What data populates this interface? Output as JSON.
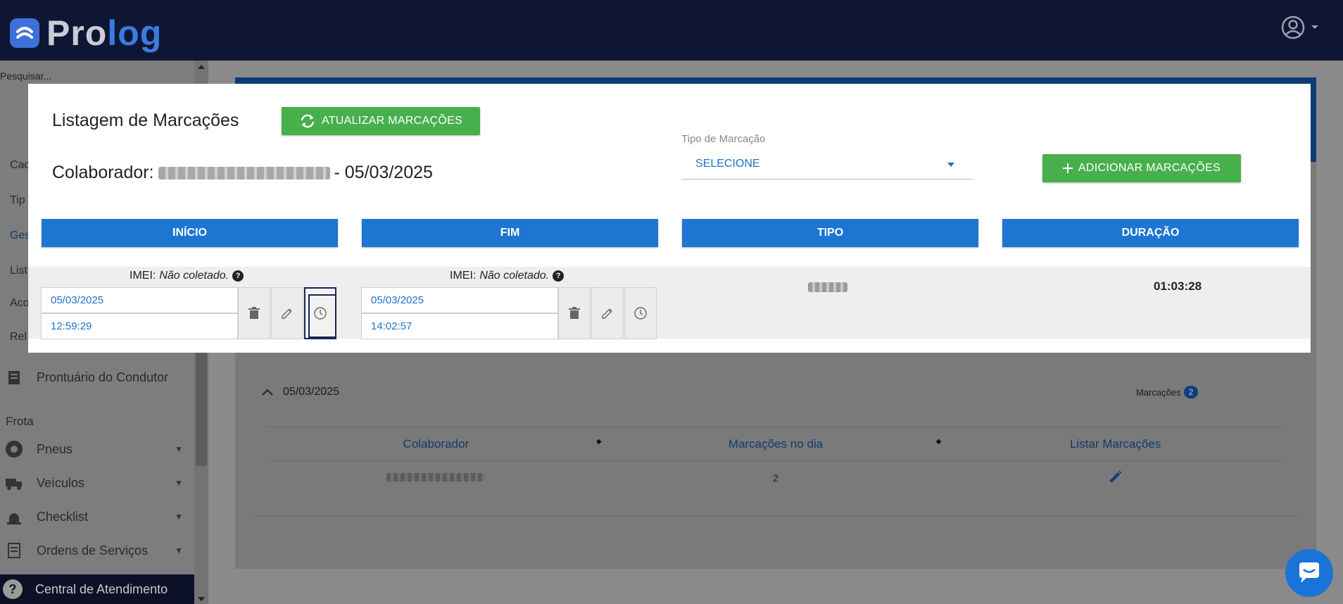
{
  "header": {
    "logo_pro": "Pro",
    "logo_log": "log"
  },
  "sidebar": {
    "search_placeholder": "Pesquisar...",
    "partial_items": [
      "Cad",
      "Tip",
      "Ges",
      "List",
      "Aco",
      "Rel"
    ],
    "prontuario": "Prontuário do Condutor",
    "section_frota": "Frota",
    "items": [
      {
        "label": "Pneus"
      },
      {
        "label": "Veículos"
      },
      {
        "label": "Checklist"
      },
      {
        "label": "Ordens de Serviços"
      }
    ],
    "central": "Central de Atendimento"
  },
  "background": {
    "day_label": "05/03/2025",
    "marcacoes_label": "Marcações",
    "marcacoes_count": "2",
    "table_headers": [
      "Colaborador",
      "Marcações no dia",
      "Listar Marcações"
    ],
    "row_count": "2"
  },
  "modal": {
    "title": "Listagem de Marcações",
    "refresh_button": "ATUALIZAR MARCAÇÕES",
    "collab_prefix": "Colaborador:",
    "collab_date": "- 05/03/2025",
    "tipo_label": "Tipo de Marcação",
    "tipo_value": "SELECIONE",
    "add_button": "ADICIONAR MARCAÇÕES",
    "columns": [
      "INÍCIO",
      "FIM",
      "TIPO",
      "DURAÇÃO"
    ],
    "imei_prefix": "IMEI:",
    "imei_value": "Não coletado.",
    "inicio": {
      "date": "05/03/2025",
      "time": "12:59:29"
    },
    "fim": {
      "date": "05/03/2025",
      "time": "14:02:57"
    },
    "duracao": "01:03:28"
  },
  "colors": {
    "accent_blue": "#1c76d2",
    "green": "#48af4d",
    "navy": "#0f1634"
  }
}
